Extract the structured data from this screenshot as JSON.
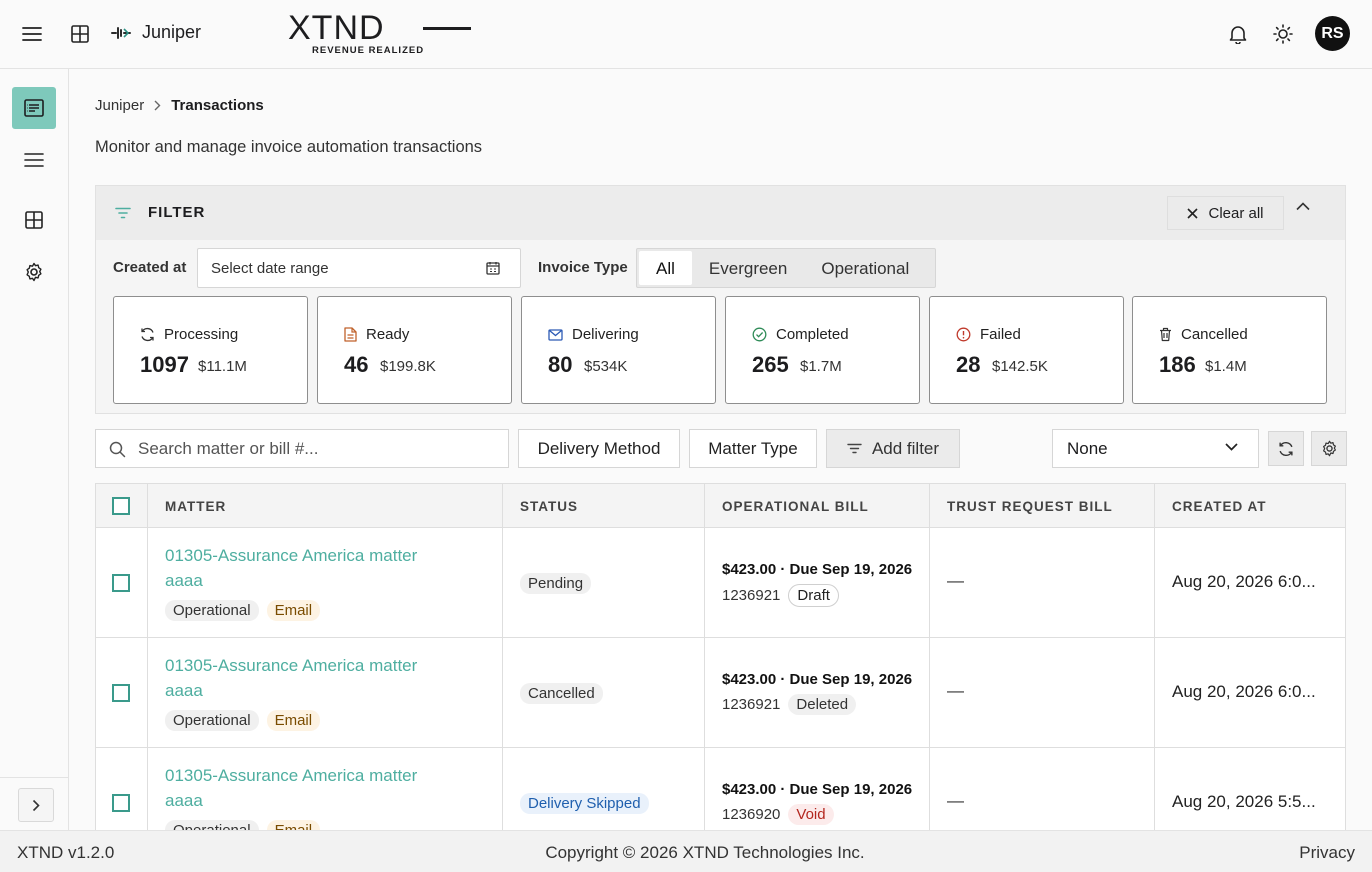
{
  "header": {
    "app_name": "Juniper",
    "logo_word": "XTND",
    "logo_tagline": "REVENUE REALIZED",
    "user_initials": "RS"
  },
  "breadcrumb": {
    "parent": "Juniper",
    "current": "Transactions"
  },
  "subtitle": "Monitor and manage invoice automation transactions",
  "filter": {
    "title": "FILTER",
    "clear_label": "Clear all",
    "created_label": "Created at",
    "date_placeholder": "Select date range",
    "invoice_label": "Invoice Type",
    "invoice_options": [
      "All",
      "Evergreen",
      "Operational"
    ]
  },
  "stats": [
    {
      "label": "Processing",
      "count": "1097",
      "amount": "$11.1M",
      "icon": "refresh-icon"
    },
    {
      "label": "Ready",
      "count": "46",
      "amount": "$199.8K",
      "icon": "document-icon"
    },
    {
      "label": "Delivering",
      "count": "80",
      "amount": "$534K",
      "icon": "mail-icon"
    },
    {
      "label": "Completed",
      "count": "265",
      "amount": "$1.7M",
      "icon": "check-circle-icon"
    },
    {
      "label": "Failed",
      "count": "28",
      "amount": "$142.5K",
      "icon": "alert-circle-icon"
    },
    {
      "label": "Cancelled",
      "count": "186",
      "amount": "$1.4M",
      "icon": "trash-icon"
    }
  ],
  "toolbar": {
    "search_placeholder": "Search matter or bill #...",
    "delivery_method": "Delivery Method",
    "matter_type": "Matter Type",
    "add_filter": "Add filter",
    "group_by_value": "None"
  },
  "table": {
    "columns": [
      "MATTER",
      "STATUS",
      "OPERATIONAL BILL",
      "TRUST REQUEST BILL",
      "CREATED AT"
    ],
    "rows": [
      {
        "matter": "01305-Assurance America matter aaaa",
        "tags": [
          "Operational",
          "Email"
        ],
        "status": "Pending",
        "bill_amount": "$423.00 · Due Sep 19, 2026",
        "bill_number": "1236921",
        "bill_state": "Draft",
        "trust": "—",
        "created": "Aug 20, 2026 6:0..."
      },
      {
        "matter": "01305-Assurance America matter aaaa",
        "tags": [
          "Operational",
          "Email"
        ],
        "status": "Cancelled",
        "bill_amount": "$423.00 · Due Sep 19, 2026",
        "bill_number": "1236921",
        "bill_state": "Deleted",
        "trust": "—",
        "created": "Aug 20, 2026 6:0..."
      },
      {
        "matter": "01305-Assurance America matter aaaa",
        "tags": [
          "Operational",
          "Email"
        ],
        "status": "Delivery Skipped",
        "bill_amount": "$423.00 · Due Sep 19, 2026",
        "bill_number": "1236920",
        "bill_state": "Void",
        "trust": "—",
        "created": "Aug 20, 2026 5:5..."
      }
    ]
  },
  "footer": {
    "version": "XTND v1.2.0",
    "copyright": "Copyright © 2026 XTND Technologies Inc.",
    "privacy": "Privacy"
  },
  "colors": {
    "accent": "#7ec9bb",
    "link": "#4eaea0",
    "checkbox": "#3a9a8b"
  }
}
